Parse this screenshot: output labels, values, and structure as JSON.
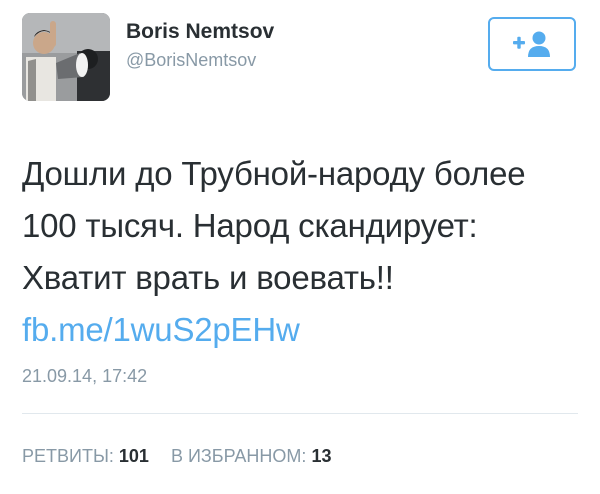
{
  "profile": {
    "display_name": "Boris Nemtsov",
    "handle": "@BorisNemtsov"
  },
  "follow_button": {
    "icon": "add-user-icon",
    "color": "#55acee"
  },
  "tweet": {
    "text": "Дошли до Трубной-народу более 100 тысяч. Народ скандирует: Хватит врать и воевать!!",
    "link": "fb.me/1wuS2pEHw",
    "timestamp": "21.09.14, 17:42"
  },
  "stats": {
    "retweets_label": "РЕТВИТЫ:",
    "retweets_count": "101",
    "favorites_label": "В ИЗБРАННОМ:",
    "favorites_count": "13"
  },
  "colors": {
    "link": "#55acee",
    "text": "#292f33",
    "muted": "#8899a6",
    "divider": "#e1e8ed"
  }
}
